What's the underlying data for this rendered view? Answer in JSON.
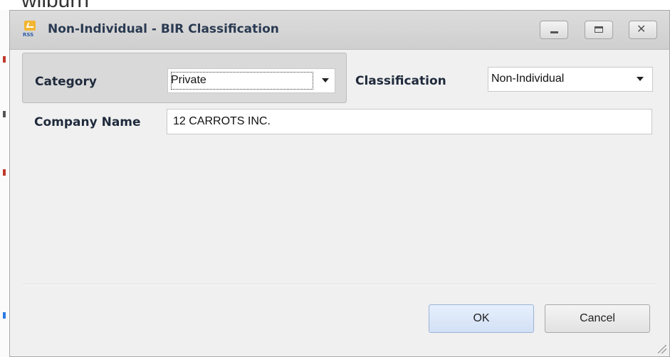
{
  "background_app": {
    "heading_fragment": "wilburn",
    "edge_marks": [
      "#c0392b",
      "#c0392b",
      "#555555",
      "#2c7be5"
    ]
  },
  "window": {
    "title": "Non-Individual - BIR Classification",
    "icon": "app-logo-icon",
    "icon_text": "RSS",
    "controls": [
      "minimize-icon",
      "maximize-icon",
      "close-icon"
    ]
  },
  "form": {
    "category_label": "Category",
    "category_value": "Private",
    "classification_label": "Classification",
    "classification_value": "Non-Individual",
    "company_name_label": "Company Name",
    "company_name_value": "12 CARROTS INC."
  },
  "buttons": {
    "ok_label": "OK",
    "cancel_label": "Cancel"
  },
  "colors": {
    "title_text": "#2a3a52",
    "ok_button": "#d9e6f8",
    "category_panel": "#d9d9d9"
  }
}
